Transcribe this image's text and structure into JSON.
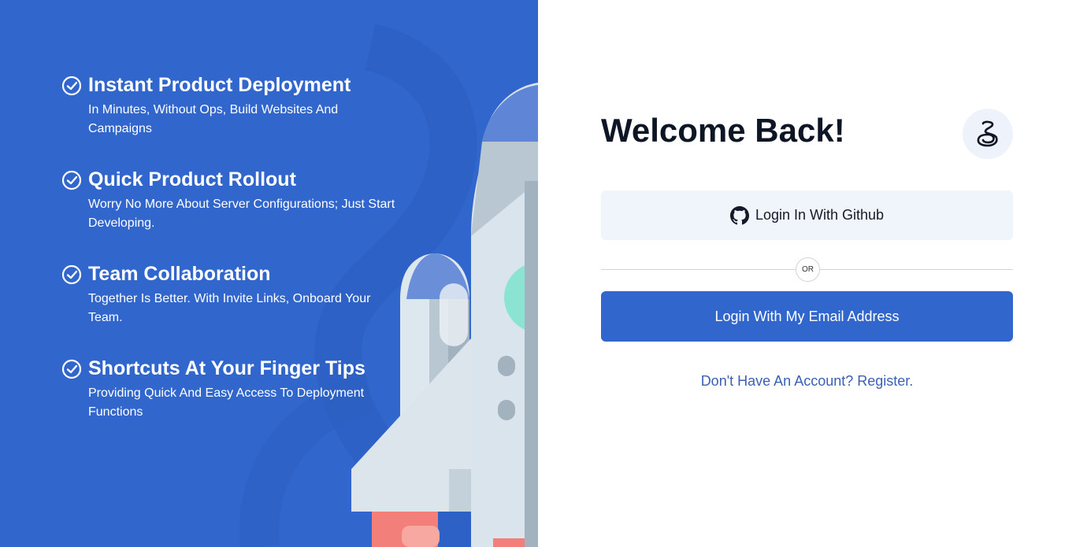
{
  "features": [
    {
      "title": "Instant Product Deployment",
      "description": "In Minutes, Without Ops, Build Websites And Campaigns"
    },
    {
      "title": "Quick Product Rollout",
      "description": "Worry No More About Server Configurations; Just Start Developing."
    },
    {
      "title": "Team Collaboration",
      "description": "Together Is Better. With Invite Links, Onboard Your Team."
    },
    {
      "title": "Shortcuts At Your Finger Tips",
      "description": "Providing Quick And Easy Access To Deployment Functions"
    }
  ],
  "login": {
    "heading": "Welcome Back!",
    "github_label": "Login In With Github",
    "or_label": "OR",
    "email_label": "Login With My Email Address",
    "register_link": "Don't Have An Account? Register."
  },
  "colors": {
    "brand": "#3166cc",
    "heading": "#0e1625",
    "link": "#3b5fb5",
    "github_bg": "#f0f5fc"
  },
  "icons": [
    "check-circle-icon",
    "brand-logo-icon",
    "github-icon",
    "rocket-illustration"
  ]
}
